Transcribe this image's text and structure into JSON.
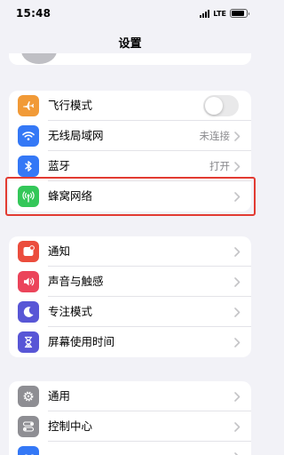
{
  "status_bar": {
    "time": "15:48",
    "network": "LTE",
    "battery_level": 0.85
  },
  "nav": {
    "title": "设置"
  },
  "groups": [
    {
      "rows": [
        {
          "label": "飞行模式",
          "icon": "airplane-icon",
          "icon_color": "#f19a37",
          "control": "toggle",
          "toggle_on": false
        },
        {
          "label": "无线局域网",
          "icon": "wifi-icon",
          "icon_color": "#3478f6",
          "value": "未连接",
          "control": "chevron"
        },
        {
          "label": "蓝牙",
          "icon": "bluetooth-icon",
          "icon_color": "#3478f6",
          "value": "打开",
          "control": "chevron"
        },
        {
          "label": "蜂窝网络",
          "icon": "cellular-antenna-icon",
          "icon_color": "#34c759",
          "control": "chevron",
          "highlighted": true
        }
      ]
    },
    {
      "rows": [
        {
          "label": "通知",
          "icon": "bell-icon",
          "icon_color": "#eb4d3d",
          "control": "chevron"
        },
        {
          "label": "声音与触感",
          "icon": "speaker-icon",
          "icon_color": "#eb445a",
          "control": "chevron"
        },
        {
          "label": "专注模式",
          "icon": "moon-icon",
          "icon_color": "#5856d6",
          "control": "chevron"
        },
        {
          "label": "屏幕使用时间",
          "icon": "hourglass-icon",
          "icon_color": "#5856d6",
          "control": "chevron"
        }
      ]
    },
    {
      "rows": [
        {
          "label": "通用",
          "icon": "gear-icon",
          "icon_color": "#8e8e93",
          "control": "chevron"
        },
        {
          "label": "控制中心",
          "icon": "switches-icon",
          "icon_color": "#8e8e93",
          "control": "chevron"
        },
        {
          "label": "",
          "icon": "display-icon",
          "icon_color": "#3478f6",
          "control": "chevron"
        }
      ]
    }
  ],
  "colors": {
    "highlight_border": "#e23b32",
    "chevron": "#c4c4c7",
    "background": "#f2f2f7"
  }
}
